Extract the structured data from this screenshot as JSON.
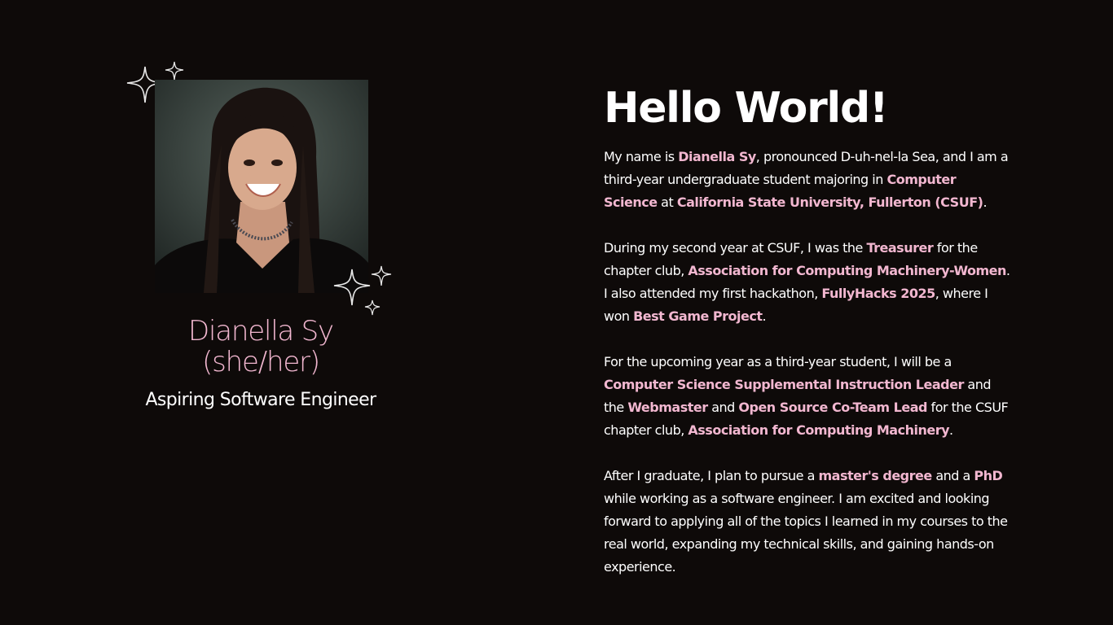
{
  "profile": {
    "photo_alt": "Portrait photo",
    "name": "Dianella Sy",
    "pronouns": "(she/her)",
    "subtitle": "Aspiring Software Engineer"
  },
  "about": {
    "heading": "Hello World!",
    "p1": {
      "t1": "My name is ",
      "h1": "Dianella Sy",
      "t2": ", pronounced D-uh-nel-la Sea, and I am a third-year undergraduate student majoring in ",
      "h2": "Computer Science",
      "t3": " at ",
      "h3": "California State University, Fullerton (CSUF)",
      "t4": "."
    },
    "p2": {
      "t1": "During my second year at CSUF, I was the ",
      "h1": "Treasurer",
      "t2": " for the chapter club, ",
      "h2": "Association for Computing Machinery-Women",
      "t3": ". I also attended my first hackathon, ",
      "h3": "FullyHacks 2025",
      "t4": ", where I won ",
      "h4": "Best Game Project",
      "t5": "."
    },
    "p3": {
      "t1": "For the upcoming year as a third-year student, I will be a ",
      "h1": "Computer Science Supplemental Instruction Leader",
      "t2": " and the ",
      "h2": "Webmaster",
      "t3": " and ",
      "h3": "Open Source Co-Team Lead",
      "t4": " for the CSUF chapter club, ",
      "h4": "Association for Computing Machinery",
      "t5": "."
    },
    "p4": {
      "t1": "After I graduate, I plan to pursue a ",
      "h1": "master's degree",
      "t2": " and a ",
      "h2": "PhD",
      "t3": " while working as a software engineer. I am excited and looking forward to applying all of the topics I learned in my courses to the real world, expanding my technical skills, and gaining hands-on experience."
    }
  },
  "colors": {
    "background": "#0e0a09",
    "accent_pink": "#f2b7d0",
    "text": "#ffffff"
  },
  "icons": [
    "sparkle-icon"
  ]
}
